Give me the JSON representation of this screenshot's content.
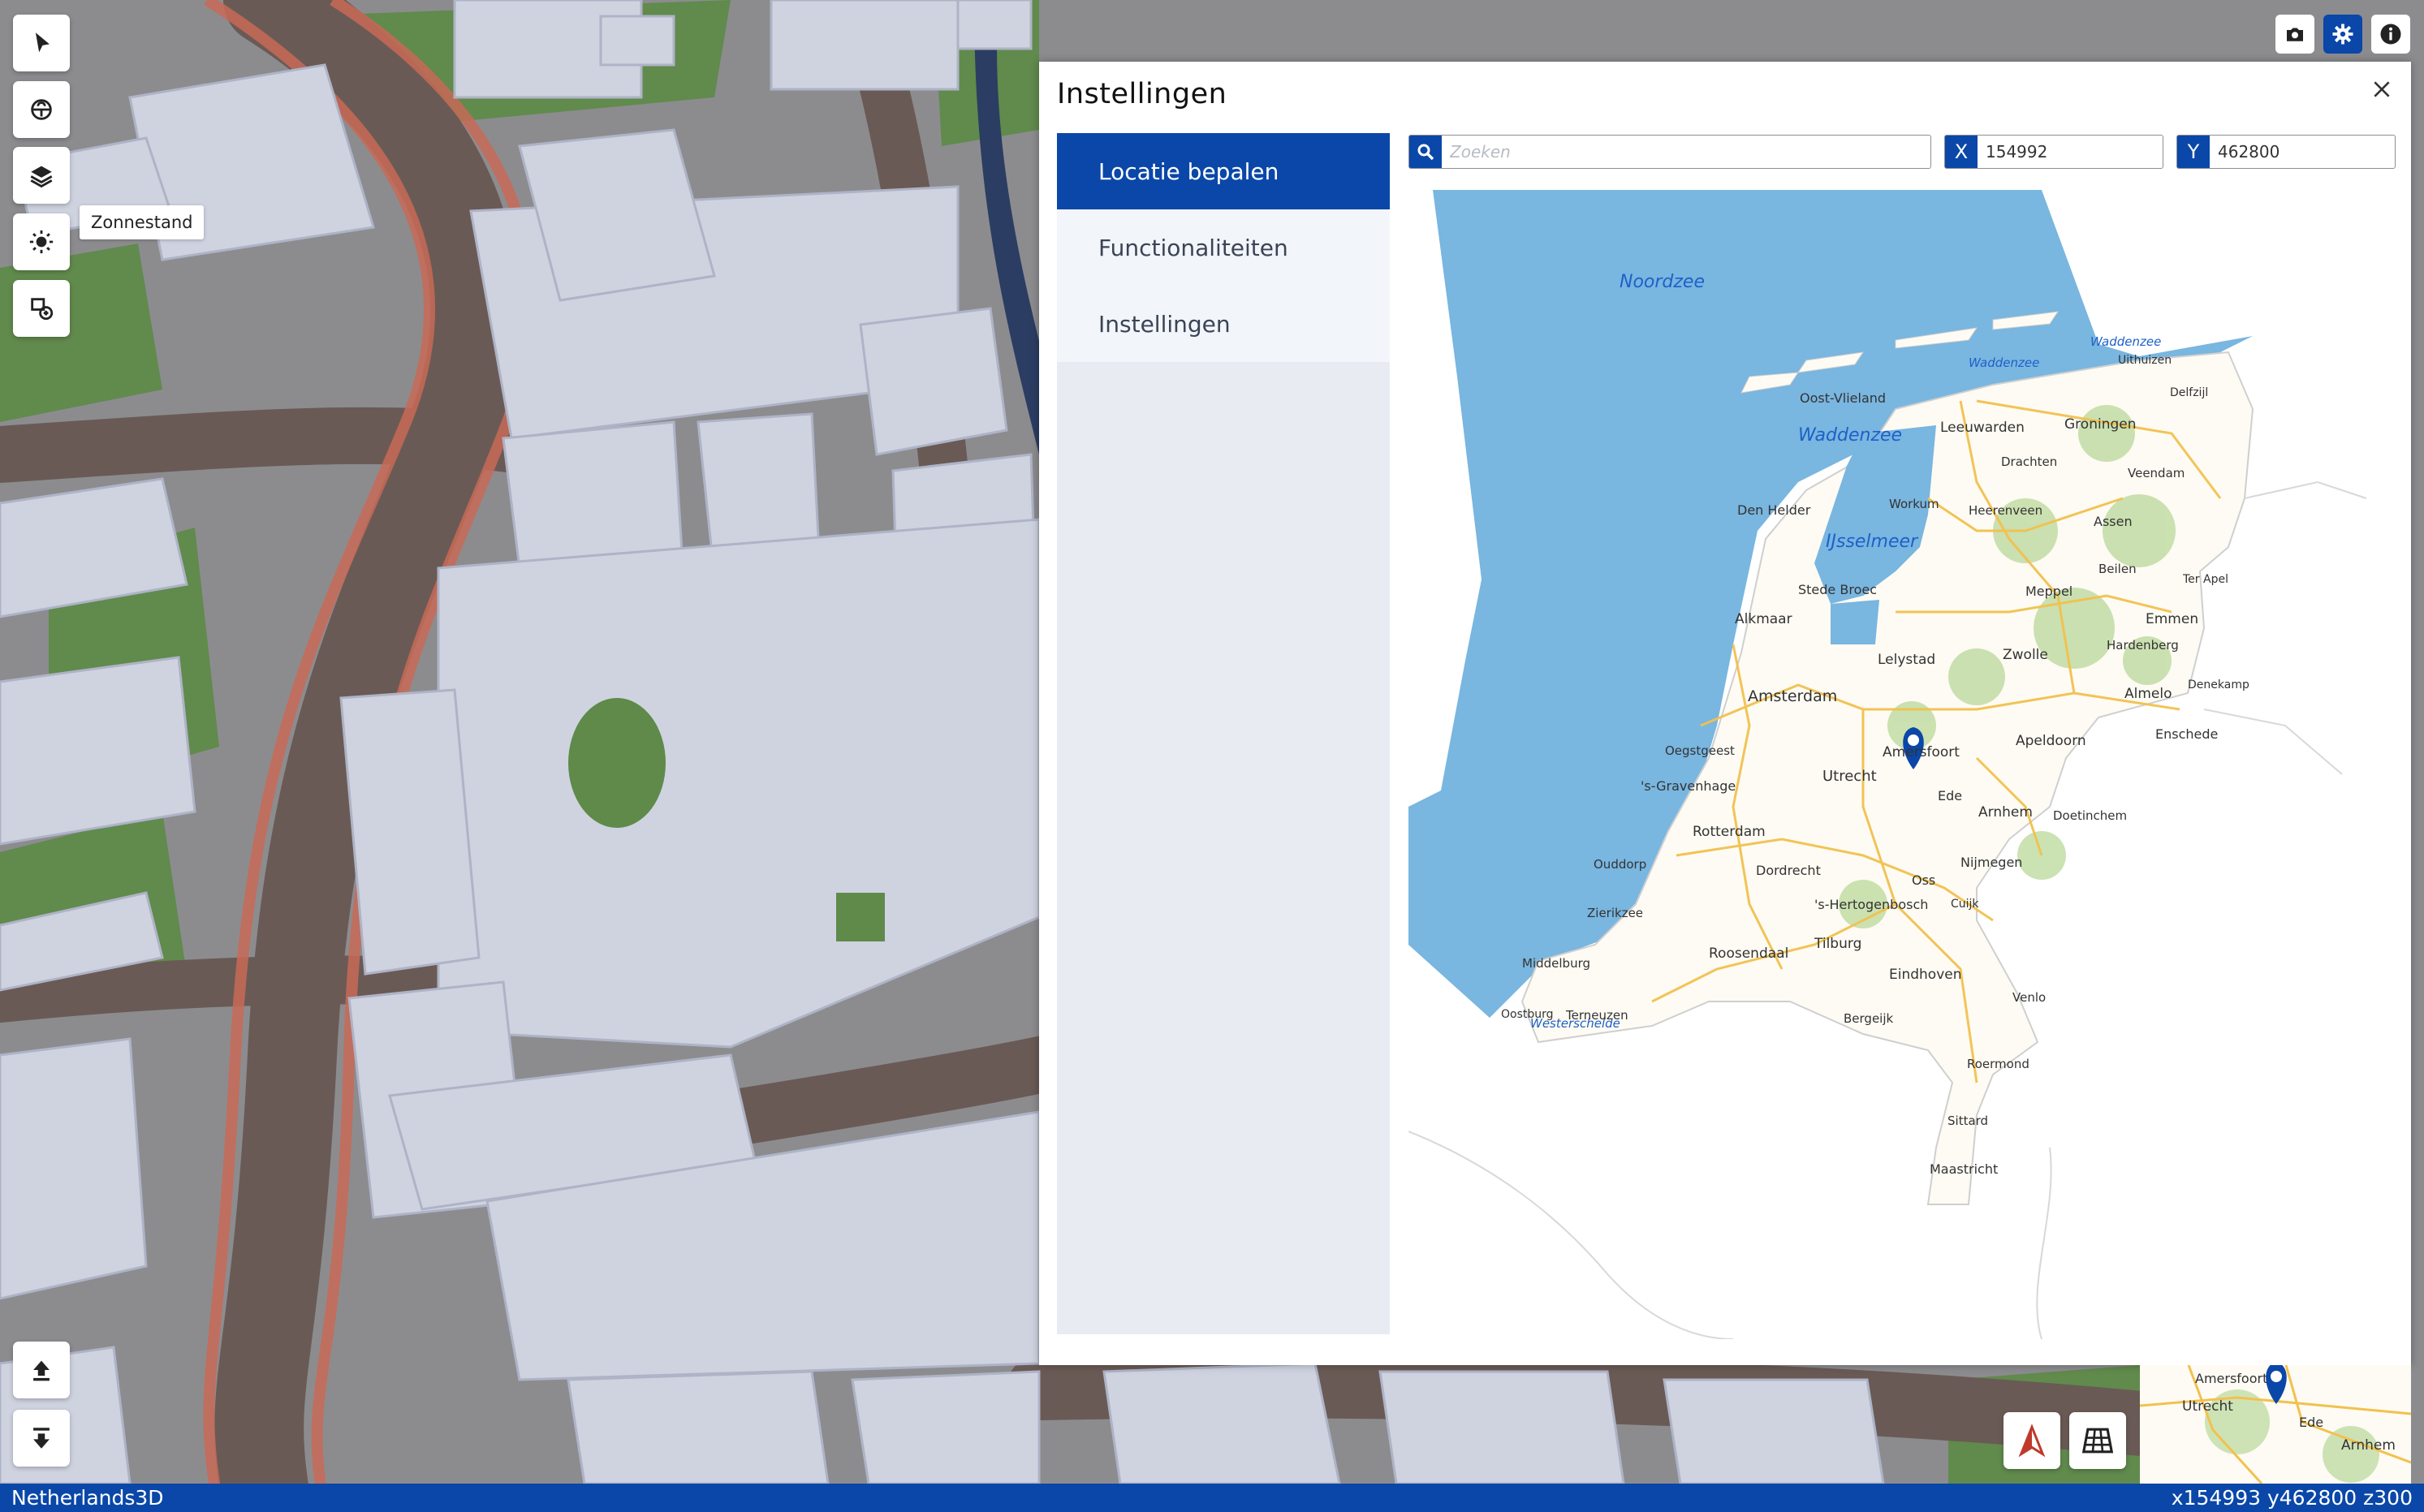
{
  "app": {
    "name": "Netherlands3D",
    "coordinates_readout": "x154993 y462800 z300"
  },
  "toolbar": {
    "items": [
      {
        "icon": "cursor-icon"
      },
      {
        "icon": "underground-icon"
      },
      {
        "icon": "layers-icon"
      },
      {
        "icon": "sun-icon"
      },
      {
        "icon": "import-icon"
      }
    ],
    "tooltip": "Zonnestand"
  },
  "top_icons": [
    {
      "icon": "camera-icon"
    },
    {
      "icon": "gear-icon",
      "active": true
    },
    {
      "icon": "info-icon"
    }
  ],
  "panel": {
    "title": "Instellingen",
    "nav": [
      {
        "label": "Locatie bepalen",
        "active": true
      },
      {
        "label": "Functionaliteiten",
        "active": false
      },
      {
        "label": "Instellingen",
        "active": false
      }
    ],
    "search": {
      "placeholder": "Zoeken",
      "icon": "search-icon"
    },
    "x_field": {
      "label": "X",
      "value": "154992"
    },
    "y_field": {
      "label": "Y",
      "value": "462800"
    }
  },
  "map": {
    "labels": {
      "sea": [
        "Noordzee",
        "Waddenzee",
        "Waddenzee",
        "Waddenzee",
        "IJsselmeer",
        "Westerschelde"
      ],
      "islands": [
        "Oost-Vlieland",
        "Uithuizen",
        "Delfzijl"
      ],
      "cities": [
        "Leeuwarden",
        "Groningen",
        "Drachten",
        "Veendam",
        "Den Helder",
        "Workum",
        "Heerenveen",
        "Assen",
        "Beilen",
        "Ter Apel",
        "Stede Broec",
        "Meppel",
        "Emmen",
        "Alkmaar",
        "Hardenberg",
        "Lelystad",
        "Zwolle",
        "Denekamp",
        "Amsterdam",
        "Almelo",
        "Enschede",
        "Oegstgeest",
        "Amersfoort",
        "Apeldoorn",
        "'s-Gravenhage",
        "Utrecht",
        "Ede",
        "Arnhem",
        "Doetinchem",
        "Rotterdam",
        "Ouddorp",
        "Nijmegen",
        "Dordrecht",
        "Oss",
        "Cuijk",
        "'s-Hertogenbosch",
        "Zierikzee",
        "Tilburg",
        "Roosendaal",
        "Middelburg",
        "Eindhoven",
        "Oostburg",
        "Terneuzen",
        "Venlo",
        "Bergeijk",
        "Roermond",
        "Sittard",
        "Maastricht"
      ]
    }
  },
  "bottom": {
    "left_buttons": [
      {
        "icon": "upload-icon"
      },
      {
        "icon": "download-icon"
      }
    ],
    "right_buttons": [
      {
        "icon": "north-arrow-icon"
      },
      {
        "icon": "grid-map-icon"
      }
    ],
    "minimap_labels": [
      "Amersfoort",
      "Utrecht",
      "Ede",
      "Arnhem"
    ]
  },
  "colors": {
    "brand": "#0a47a8",
    "water": "#79b6e0",
    "panel_nav": "#e8ecf2"
  }
}
